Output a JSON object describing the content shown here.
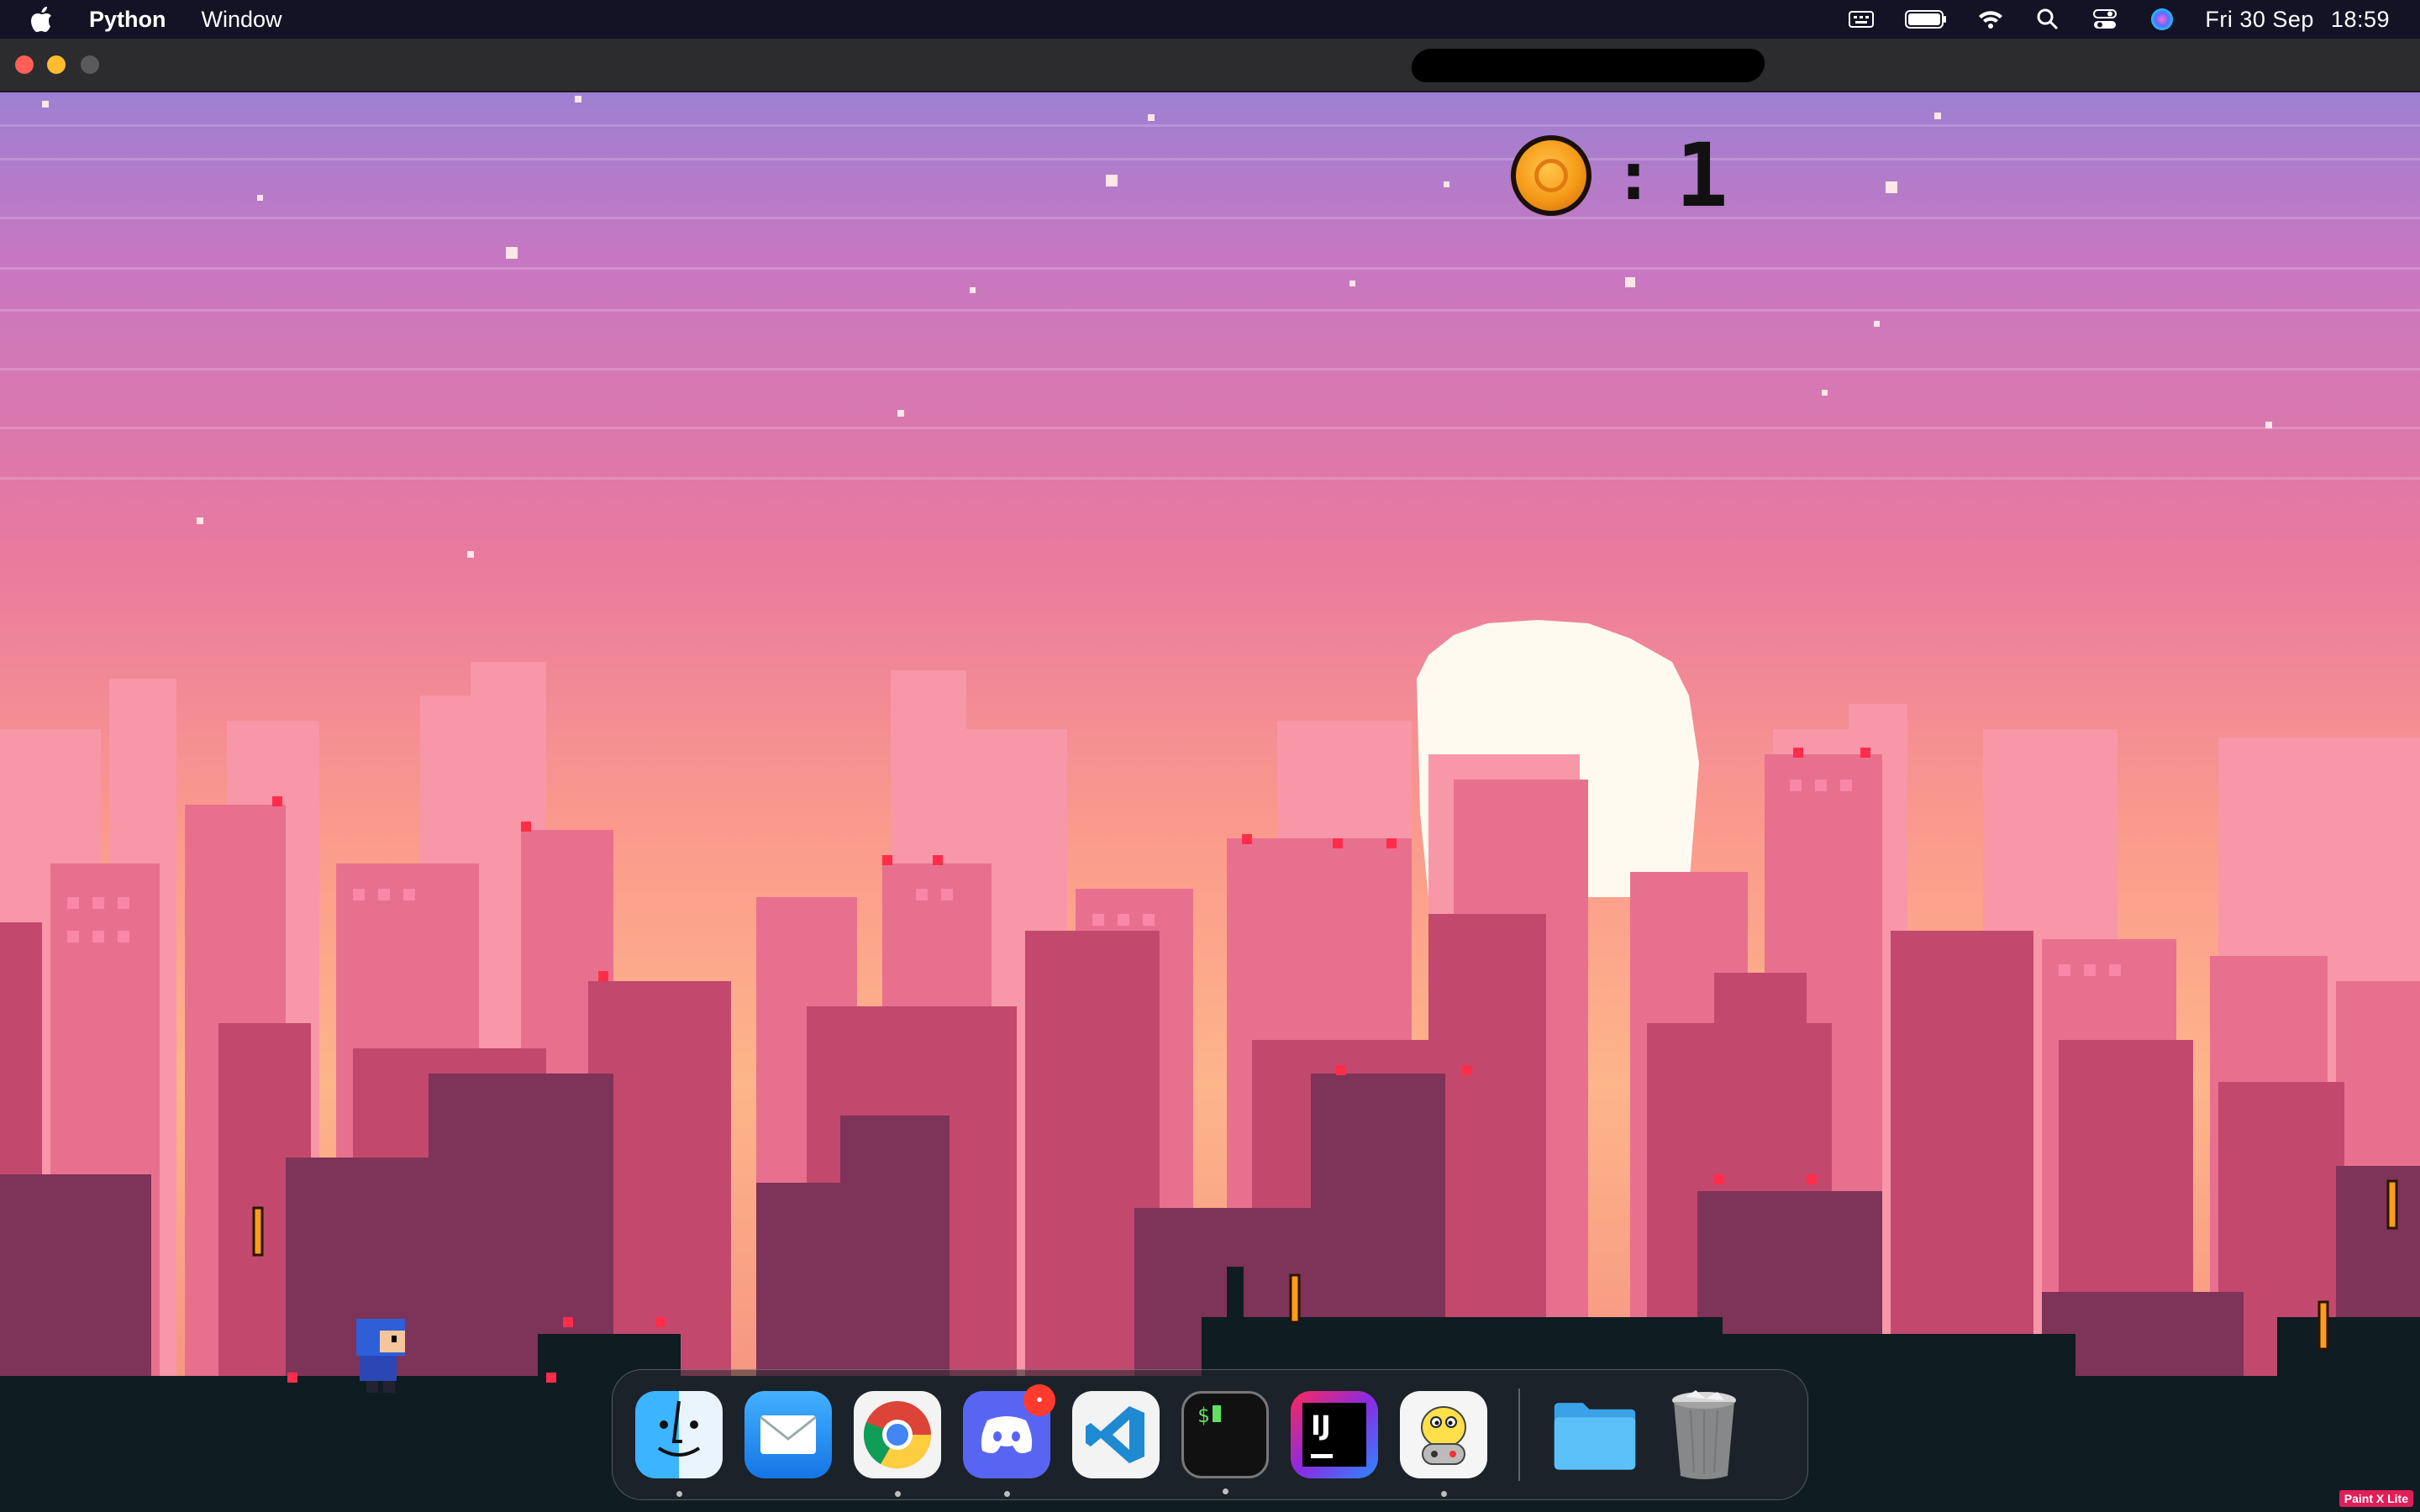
{
  "menubar": {
    "app_name": "Python",
    "menu_items": [
      "Window"
    ],
    "clock": {
      "day": "Fri 30 Sep",
      "time": "18:59"
    },
    "status_icons": [
      "keyboard-icon",
      "battery-icon",
      "wifi-icon",
      "search-icon",
      "control-center-icon",
      "siri-icon"
    ]
  },
  "game": {
    "coin_icon": "coin-icon",
    "hud_separator": ":",
    "coin_count": "1"
  },
  "dock": {
    "apps": [
      {
        "name": "Finder",
        "icon": "finder-icon",
        "running": true
      },
      {
        "name": "Mail",
        "icon": "mail-icon",
        "running": false
      },
      {
        "name": "Google Chrome",
        "icon": "chrome-icon",
        "running": true
      },
      {
        "name": "Discord",
        "icon": "discord-icon",
        "running": true,
        "badge": "•"
      },
      {
        "name": "Visual Studio Code",
        "icon": "vscode-icon",
        "running": false
      },
      {
        "name": "Terminal",
        "icon": "terminal-icon",
        "running": true
      },
      {
        "name": "IntelliJ IDEA",
        "icon": "intellij-icon",
        "running": false
      },
      {
        "name": "Python Launcher",
        "icon": "python-icon",
        "running": true
      }
    ],
    "extras": [
      {
        "name": "Downloads",
        "icon": "folder-icon"
      },
      {
        "name": "Trash",
        "icon": "trash-icon"
      }
    ],
    "intellij_text": "IJ",
    "terminal_text": "$"
  },
  "corner_tag": "Paint X Lite",
  "colors": {
    "sky_top": "#9b7fd0",
    "sky_mid": "#e97aa0",
    "sky_low": "#fba98a",
    "far_buildings": "#f38fa5",
    "mid_buildings": "#d9607e",
    "near_buildings": "#a3405e",
    "front_buildings": "#5c2a46",
    "silhouette": "#0f1c22",
    "sun": "#fffaf0"
  }
}
